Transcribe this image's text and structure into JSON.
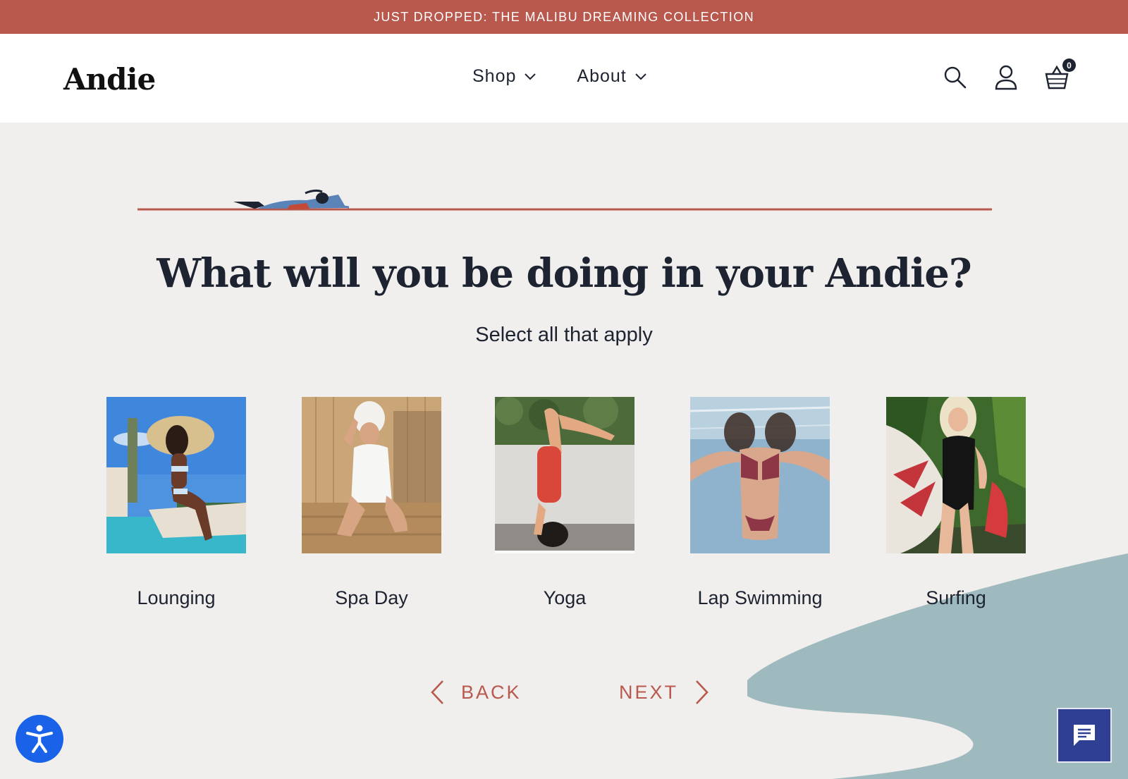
{
  "announcement": "JUST DROPPED: THE MALIBU DREAMING COLLECTION",
  "header": {
    "logo": "Andie",
    "nav": [
      {
        "label": "Shop"
      },
      {
        "label": "About"
      }
    ],
    "cart_count": "0"
  },
  "quiz": {
    "title": "What will you be doing in your Andie?",
    "subtitle": "Select all that apply",
    "options": [
      {
        "label": "Lounging"
      },
      {
        "label": "Spa Day"
      },
      {
        "label": "Yoga"
      },
      {
        "label": "Lap Swimming"
      },
      {
        "label": "Surfing"
      }
    ],
    "back_label": "BACK",
    "next_label": "NEXT"
  },
  "colors": {
    "accent": "#b9584d",
    "background": "#f1efed",
    "wave": "#9fbabe",
    "text": "#1d2330",
    "accessibility": "#1a63e8",
    "chat": "#2f3f93"
  },
  "icons": [
    "search-icon",
    "account-icon",
    "cart-icon",
    "chevron-down-icon",
    "chevron-left-icon",
    "chevron-right-icon",
    "accessibility-icon",
    "chat-icon"
  ]
}
